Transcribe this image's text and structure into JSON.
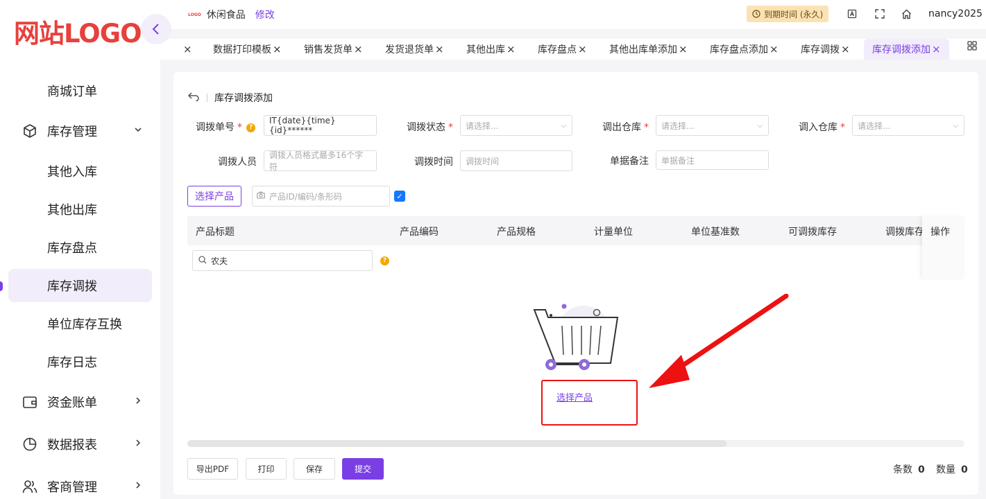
{
  "sidebar": {
    "logo": "网站LOGO",
    "items": [
      {
        "label": "商城订单"
      },
      {
        "label": "库存管理"
      },
      {
        "label": "其他入库"
      },
      {
        "label": "其他出库"
      },
      {
        "label": "库存盘点"
      },
      {
        "label": "库存调拨"
      },
      {
        "label": "单位库存互换"
      },
      {
        "label": "库存日志"
      },
      {
        "label": "资金账单"
      },
      {
        "label": "数据报表"
      },
      {
        "label": "客商管理"
      }
    ]
  },
  "header": {
    "mini_logo": "LOGO",
    "shop_name": "休闲食品",
    "edit_label": "修改",
    "expire_label": "到期时间 (永久)",
    "username": "nancy2025"
  },
  "tabs": [
    {
      "label": "数据打印模板"
    },
    {
      "label": "销售发货单"
    },
    {
      "label": "发货退货单"
    },
    {
      "label": "其他出库"
    },
    {
      "label": "库存盘点"
    },
    {
      "label": "其他出库单添加"
    },
    {
      "label": "库存盘点添加"
    },
    {
      "label": "库存调拨"
    },
    {
      "label": "库存调拨添加"
    }
  ],
  "page": {
    "title": "库存调拨添加"
  },
  "form": {
    "order_no_label": "调拨单号",
    "order_no_value": "IT{date}{time}{id}******",
    "status_label": "调拨状态",
    "status_placeholder": "请选择...",
    "out_wh_label": "调出仓库",
    "out_wh_placeholder": "请选择...",
    "in_wh_label": "调入仓库",
    "in_wh_placeholder": "请选择...",
    "staff_label": "调拨人员",
    "staff_placeholder": "调拨人员格式最多16个字符",
    "time_label": "调拨时间",
    "time_placeholder": "调拨时间",
    "remark_label": "单据备注",
    "remark_placeholder": "单据备注"
  },
  "product": {
    "pick_label": "选择产品",
    "scan_placeholder": "产品ID/编码/条形码",
    "filter_value": "农夫"
  },
  "table": {
    "columns": [
      "产品标题",
      "产品编码",
      "产品规格",
      "计量单位",
      "单位基准数",
      "可调拨库存",
      "调拨库存"
    ],
    "action_column": "操作",
    "empty_link": "选择产品"
  },
  "footer": {
    "export_pdf": "导出PDF",
    "print": "打印",
    "save": "保存",
    "submit": "提交",
    "count_label": "条数",
    "count_value": "0",
    "qty_label": "数量",
    "qty_value": "0"
  },
  "colors": {
    "accent": "#7a3fe4",
    "logo": "#e8403c",
    "annotation": "#ee1111"
  }
}
